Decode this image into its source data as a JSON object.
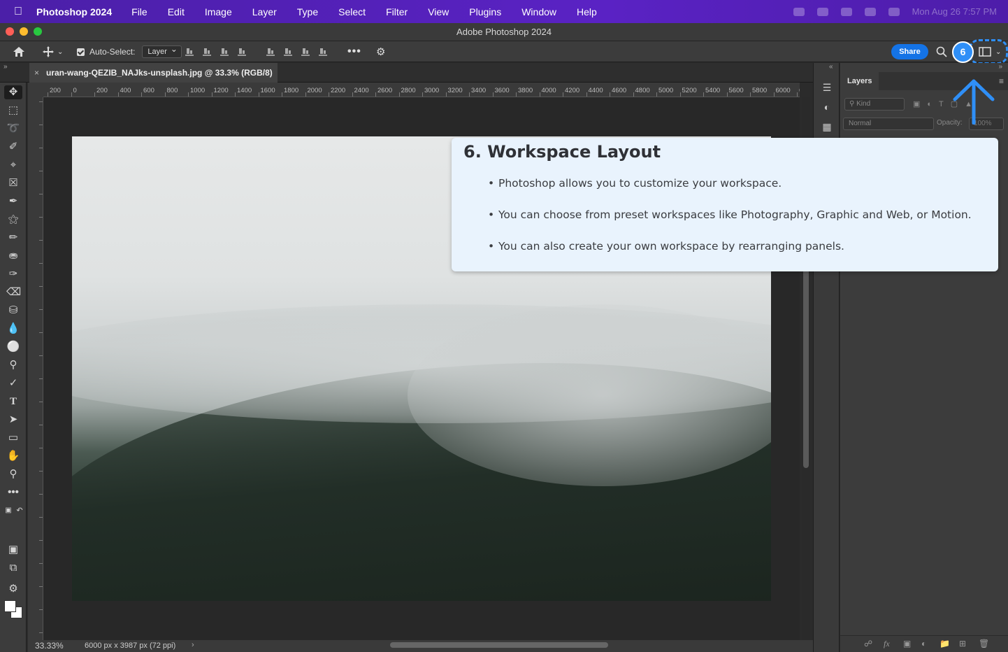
{
  "menubar": {
    "app_name": "Photoshop 2024",
    "items": [
      "File",
      "Edit",
      "Image",
      "Layer",
      "Type",
      "Select",
      "Filter",
      "View",
      "Plugins",
      "Window",
      "Help"
    ],
    "clock": "Mon Aug 26  7:57 PM"
  },
  "window": {
    "title": "Adobe Photoshop 2024"
  },
  "options": {
    "auto_select_label": "Auto-Select:",
    "auto_select_value": "Layer",
    "share_label": "Share"
  },
  "document": {
    "tab_label": "uran-wang-QEZIB_NAJks-unsplash.jpg @ 33.3% (RGB/8)",
    "zoom": "33.33%",
    "dimensions": "6000 px x 3987 px (72 ppi)"
  },
  "ruler": {
    "top_labels": [
      "200",
      "0",
      "200",
      "400",
      "600",
      "800",
      "1000",
      "1200",
      "1400",
      "1600",
      "1800",
      "2000",
      "2200",
      "2400",
      "2600",
      "2800",
      "3000",
      "3200",
      "3400",
      "3600",
      "3800",
      "4000",
      "4200",
      "4400",
      "4600",
      "4800",
      "5000",
      "5200",
      "5400",
      "5600",
      "5800",
      "6000",
      "6"
    ]
  },
  "layers_panel": {
    "tab_label": "Layers",
    "kind_placeholder": "Kind",
    "blend_mode": "Normal",
    "opacity_label": "Opacity:",
    "opacity_value": "100%"
  },
  "tutorial": {
    "step_number": "6",
    "title": "6. Workspace Layout",
    "bullets": [
      "Photoshop allows you to customize your workspace.",
      "You can choose from preset workspaces like Photography, Graphic and Web, or Motion.",
      "You can also create your own workspace by rearranging panels."
    ],
    "accent_color": "#2f8ff7"
  },
  "colors": {
    "menubar": "#5a22c4",
    "share_button": "#1473e6",
    "card_background": "#e9f3fd"
  }
}
